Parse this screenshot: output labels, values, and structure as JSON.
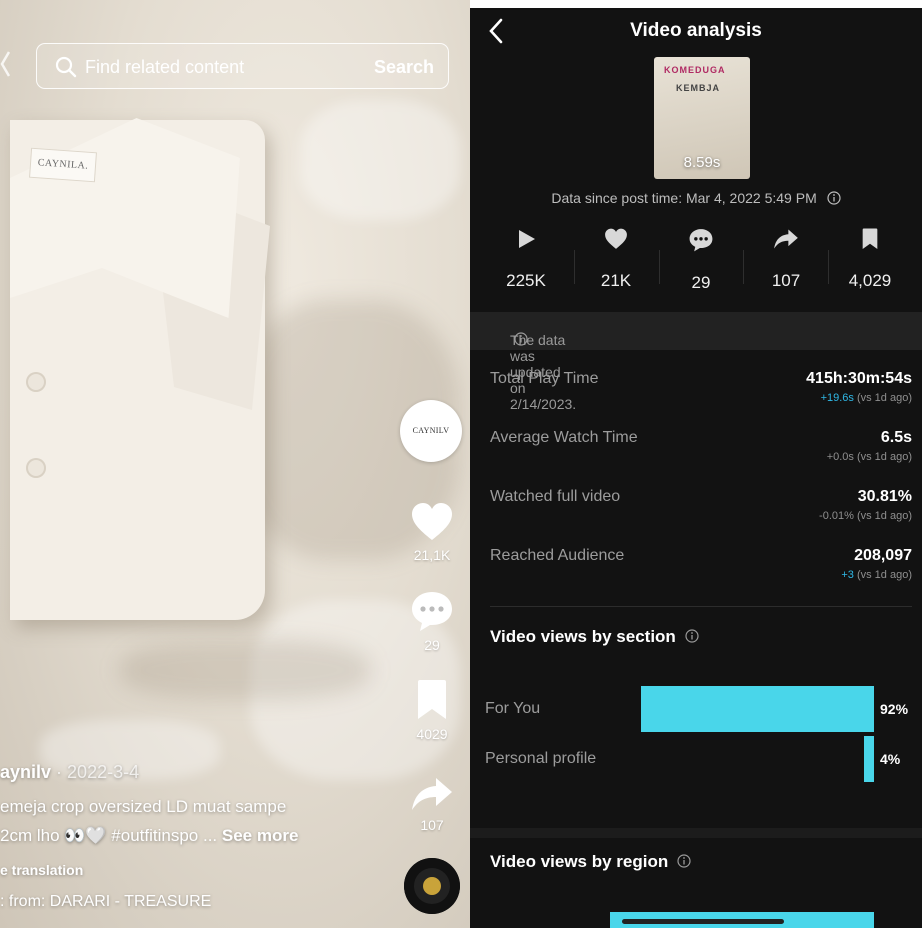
{
  "video": {
    "search": {
      "placeholder": "Find related content",
      "button": "Search"
    },
    "shirt_tag": "CAYNILA.",
    "avatar_text": "CAYNILV",
    "actions": [
      {
        "icon": "heart-icon",
        "count": "21,1K"
      },
      {
        "icon": "comment-icon",
        "count": "29"
      },
      {
        "icon": "bookmark-icon",
        "count": "4029"
      },
      {
        "icon": "share-icon",
        "count": "107"
      }
    ],
    "author": "aynilv",
    "date": "· 2022-3-4",
    "caption_line1": "emeja crop oversized LD muat sampe",
    "caption_line2": "2cm lho 👀🤍 #outfitinspo ... ",
    "see_more": "See more",
    "translation": "e translation",
    "music": ": from: DARARI - TREASURE"
  },
  "analysis": {
    "title": "Video analysis",
    "duration": "8.59s",
    "thumb_text1": "KOMEDUGA",
    "thumb_text2": "KEMBJA",
    "since": "Data since post time: Mar 4, 2022 5:49 PM",
    "stats": [
      {
        "icon": "play-icon",
        "value": "225K"
      },
      {
        "icon": "heart-icon",
        "value": "21K"
      },
      {
        "icon": "comment-icon",
        "value": "29"
      },
      {
        "icon": "share-icon",
        "value": "107"
      },
      {
        "icon": "bookmark-icon",
        "value": "4,029"
      }
    ],
    "updated": "The data was updated on 2/14/2023.",
    "metrics": [
      {
        "label": "Total Play Time",
        "value": "415h:30m:54s",
        "delta_num": "+19.6s",
        "delta_rest": " (vs 1d ago)",
        "positive": true
      },
      {
        "label": "Average Watch Time",
        "value": "6.5s",
        "delta_num": "+0.0s",
        "delta_rest": " (vs 1d ago)",
        "positive": false
      },
      {
        "label": "Watched full video",
        "value": "30.81%",
        "delta_num": "-0.01%",
        "delta_rest": " (vs 1d ago)",
        "positive": false
      },
      {
        "label": "Reached Audience",
        "value": "208,097",
        "delta_num": "+3",
        "delta_rest": " (vs 1d ago)",
        "positive": true
      }
    ],
    "section_title": "Video views by section",
    "sections": [
      {
        "label": "For You",
        "percent": 92,
        "percent_text": "92%"
      },
      {
        "label": "Personal profile",
        "percent": 4,
        "percent_text": "4%"
      }
    ],
    "region_title": "Video views by region",
    "accent": "#49d6ea"
  }
}
